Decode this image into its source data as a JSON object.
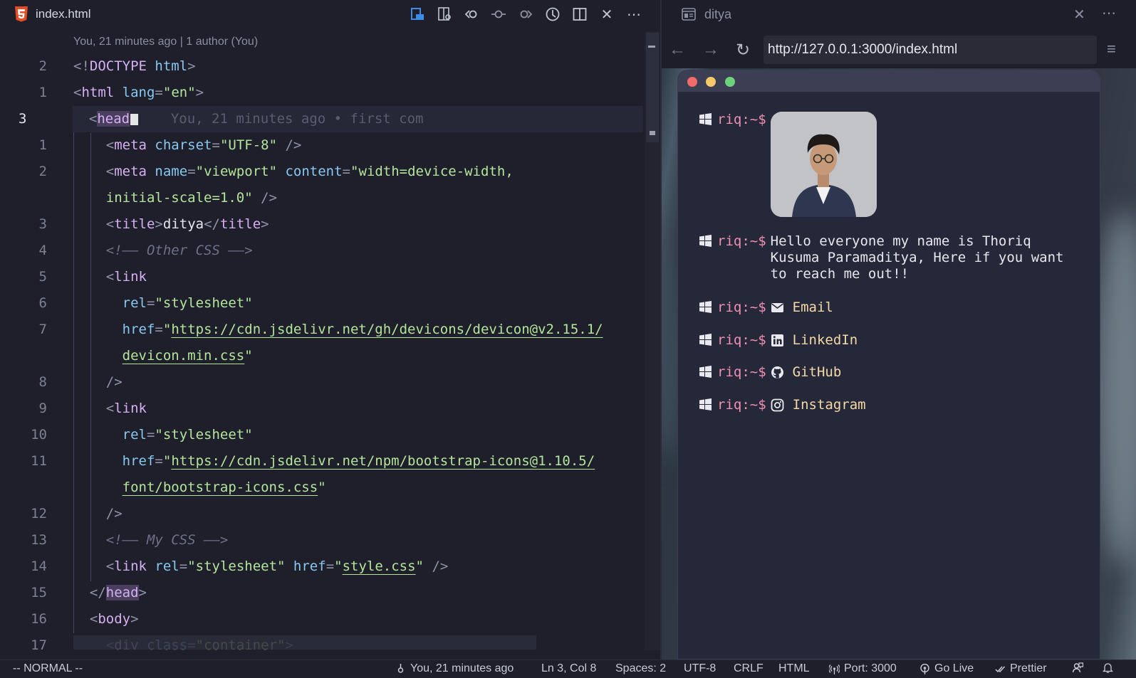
{
  "editor": {
    "tab": {
      "filename": "index.html",
      "icon": "html5-icon"
    },
    "actions": [
      "open-preview-icon",
      "inspect-icon",
      "go-back-icon",
      "git-commit-icon",
      "go-forward-icon",
      "timeline-icon",
      "split-editor-icon",
      "close-icon",
      "more-actions-icon"
    ],
    "blame_header": "You, 21 minutes ago | 1 author (You)",
    "gutter": [
      "2",
      "1",
      "3",
      "1",
      "2",
      "",
      "3",
      "4",
      "5",
      "6",
      "7",
      "",
      "8",
      "9",
      "10",
      "11",
      "",
      "12",
      "13",
      "14",
      "15",
      "16",
      "17"
    ],
    "lines": {
      "l0_a": "<!",
      "l0_b": "DOCTYPE",
      "l0_c": " html",
      "l0_d": ">",
      "l1_a": "<",
      "l1_b": "html",
      "l1_c": " lang",
      "l1_d": "=",
      "l1_e": "\"en\"",
      "l1_f": ">",
      "l2_a": "<",
      "l2_b": "head",
      "l2_blame": "    You, 21 minutes ago • first com",
      "l3_a": "<",
      "l3_b": "meta",
      "l3_c": " charset",
      "l3_d": "=",
      "l3_e": "\"UTF-8\"",
      "l3_f": " />",
      "l4_a": "<",
      "l4_b": "meta",
      "l4_c": " name",
      "l4_d": "=",
      "l4_e": "\"viewport\"",
      "l4_f": " content",
      "l4_g": "=",
      "l4_h": "\"width=device-width,",
      "l5_a": "initial-scale=1.0\"",
      "l5_b": " />",
      "l6_a": "<",
      "l6_b": "title",
      "l6_c": ">",
      "l6_d": "ditya",
      "l6_e": "</",
      "l6_f": "title",
      "l6_g": ">",
      "l7_a": "<!—— Other CSS ——>",
      "l8_a": "<",
      "l8_b": "link",
      "l9_a": "rel",
      "l9_b": "=",
      "l9_c": "\"stylesheet\"",
      "l10_a": "href",
      "l10_b": "=",
      "l10_c": "\"",
      "l10_d": "https://cdn.jsdelivr.net/gh/devicons/devicon@v2.15.1/",
      "l11_a": "devicon.min.css",
      "l11_b": "\"",
      "l12_a": "/>",
      "l13_a": "<",
      "l13_b": "link",
      "l14_a": "rel",
      "l14_b": "=",
      "l14_c": "\"stylesheet\"",
      "l15_a": "href",
      "l15_b": "=",
      "l15_c": "\"",
      "l15_d": "https://cdn.jsdelivr.net/npm/bootstrap-icons@1.10.5/",
      "l16_a": "font/bootstrap-icons.css",
      "l16_b": "\"",
      "l17_a": "/>",
      "l18_a": "<!—— My CSS ——>",
      "l19_a": "<",
      "l19_b": "link",
      "l19_c": " rel",
      "l19_d": "=",
      "l19_e": "\"stylesheet\"",
      "l19_f": " href",
      "l19_g": "=",
      "l19_h": "\"",
      "l19_i": "style.css",
      "l19_j": "\"",
      "l19_k": " />",
      "l20_a": "</",
      "l20_b": "head",
      "l20_c": ">",
      "l21_a": "<",
      "l21_b": "body",
      "l21_c": ">",
      "l22_a": "<",
      "l22_b": "div",
      "l22_c": " class",
      "l22_d": "=",
      "l22_e": "\"container\"",
      "l22_f": ">"
    }
  },
  "preview": {
    "tab_title": "ditya",
    "url": "http://127.0.0.1:3000/index.html",
    "terminal": {
      "prompt": "riq:~$",
      "intro": "Hello everyone my name is Thoriq Kusuma Paramaditya, Here if you want to reach me out!!",
      "links": [
        {
          "label": "Email",
          "icon": "envelope-icon"
        },
        {
          "label": "LinkedIn",
          "icon": "linkedin-icon"
        },
        {
          "label": "GitHub",
          "icon": "github-icon"
        },
        {
          "label": "Instagram",
          "icon": "instagram-icon"
        }
      ]
    }
  },
  "statusbar": {
    "mode": "-- NORMAL --",
    "blame": "You, 21 minutes ago",
    "position": "Ln 3, Col 8",
    "spaces": "Spaces: 2",
    "encoding": "UTF-8",
    "eol": "CRLF",
    "language": "HTML",
    "port": "Port: 3000",
    "go_live": "Go Live",
    "prettier": "Prettier"
  },
  "colors": {
    "background": "#1e1f2b",
    "tag": "#d6b0f2",
    "attribute": "#88c8f0",
    "string": "#b3e59a",
    "prompt": "#f08fb2",
    "link": "#f6d8a6"
  }
}
